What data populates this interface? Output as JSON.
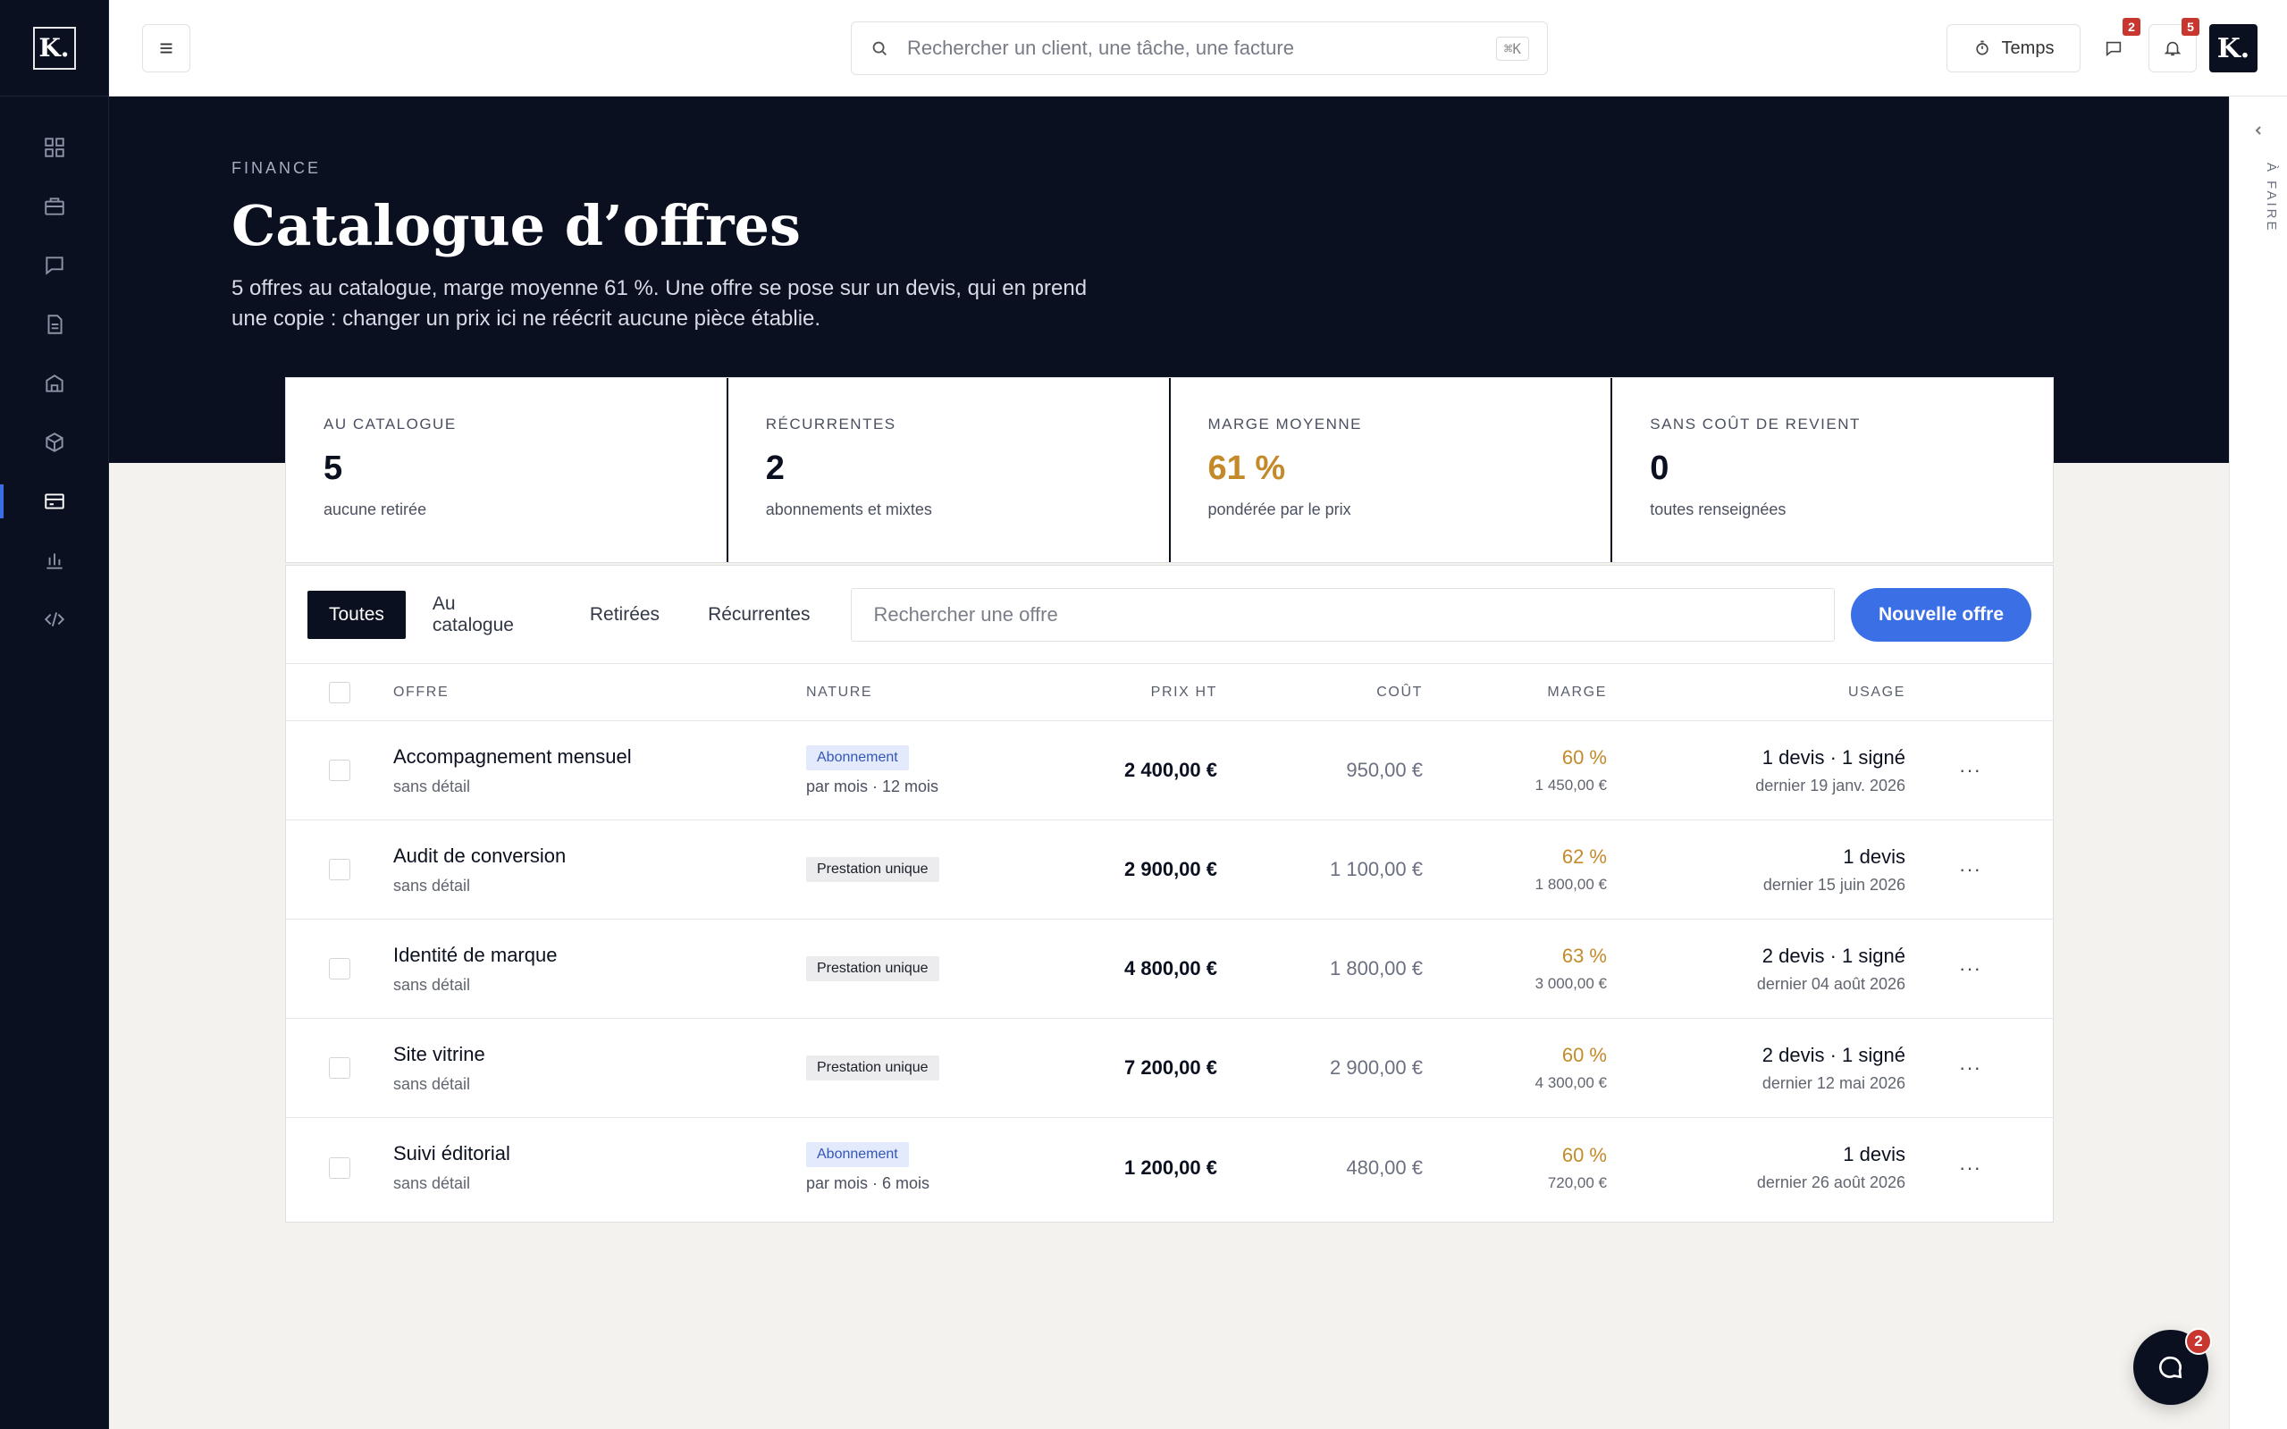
{
  "brand": {
    "logo": "K."
  },
  "sidebar": {
    "items": [
      {
        "name": "dashboard",
        "icon": "grid-icon"
      },
      {
        "name": "projects",
        "icon": "briefcase-icon"
      },
      {
        "name": "messages",
        "icon": "message-icon"
      },
      {
        "name": "documents",
        "icon": "document-icon"
      },
      {
        "name": "clients",
        "icon": "building-icon"
      },
      {
        "name": "products",
        "icon": "box-icon"
      },
      {
        "name": "finance",
        "icon": "card-icon",
        "active": true
      },
      {
        "name": "reports",
        "icon": "bar-chart-icon"
      },
      {
        "name": "developer",
        "icon": "code-icon"
      }
    ]
  },
  "topbar": {
    "search_placeholder": "Rechercher un client, une tâche, une facture",
    "search_shortcut": "⌘K",
    "timer_label": "Temps",
    "messages_badge": "2",
    "notifications_badge": "5",
    "avatar": "K."
  },
  "hero": {
    "eyebrow": "FINANCE",
    "title": "Catalogue d’offres",
    "description": "5 offres au catalogue, marge moyenne 61 %. Une offre se pose sur un devis, qui en prend une copie : changer un prix ici ne réécrit aucune pièce établie."
  },
  "rail": {
    "label": "À FAIRE"
  },
  "kpis": [
    {
      "label": "AU CATALOGUE",
      "value": "5",
      "sub": "aucune retirée",
      "accent": false
    },
    {
      "label": "RÉCURRENTES",
      "value": "2",
      "sub": "abonnements et mixtes",
      "accent": false
    },
    {
      "label": "MARGE MOYENNE",
      "value": "61 %",
      "sub": "pondérée par le prix",
      "accent": true
    },
    {
      "label": "SANS COÛT DE REVIENT",
      "value": "0",
      "sub": "toutes renseignées",
      "accent": false
    }
  ],
  "toolbar": {
    "tabs": [
      "Toutes",
      "Au catalogue",
      "Retirées",
      "Récurrentes"
    ],
    "active_tab": "Toutes",
    "search_placeholder": "Rechercher une offre",
    "new_button": "Nouvelle offre"
  },
  "table": {
    "headers": {
      "offre": "OFFRE",
      "nature": "NATURE",
      "prix": "PRIX HT",
      "cout": "COÛT",
      "marge": "MARGE",
      "usage": "USAGE"
    },
    "rows": [
      {
        "name": "Accompagnement mensuel",
        "detail": "sans détail",
        "nature": "Abonnement",
        "nature_type": "abo",
        "period": "par mois · 12 mois",
        "prix": "2 400,00 €",
        "cout": "950,00 €",
        "marge_pct": "60 %",
        "marge_abs": "1 450,00 €",
        "usage": "1 devis · 1 signé",
        "last": "dernier 19 janv. 2026"
      },
      {
        "name": "Audit de conversion",
        "detail": "sans détail",
        "nature": "Prestation unique",
        "nature_type": "uni",
        "period": "",
        "prix": "2 900,00 €",
        "cout": "1 100,00 €",
        "marge_pct": "62 %",
        "marge_abs": "1 800,00 €",
        "usage": "1 devis",
        "last": "dernier 15 juin 2026"
      },
      {
        "name": "Identité de marque",
        "detail": "sans détail",
        "nature": "Prestation unique",
        "nature_type": "uni",
        "period": "",
        "prix": "4 800,00 €",
        "cout": "1 800,00 €",
        "marge_pct": "63 %",
        "marge_abs": "3 000,00 €",
        "usage": "2 devis · 1 signé",
        "last": "dernier 04 août 2026"
      },
      {
        "name": "Site vitrine",
        "detail": "sans détail",
        "nature": "Prestation unique",
        "nature_type": "uni",
        "period": "",
        "prix": "7 200,00 €",
        "cout": "2 900,00 €",
        "marge_pct": "60 %",
        "marge_abs": "4 300,00 €",
        "usage": "2 devis · 1 signé",
        "last": "dernier 12 mai 2026"
      },
      {
        "name": "Suivi éditorial",
        "detail": "sans détail",
        "nature": "Abonnement",
        "nature_type": "abo",
        "period": "par mois · 6 mois",
        "prix": "1 200,00 €",
        "cout": "480,00 €",
        "marge_pct": "60 %",
        "marge_abs": "720,00 €",
        "usage": "1 devis",
        "last": "dernier 26 août 2026"
      }
    ],
    "row_action": "···"
  },
  "fab": {
    "badge": "2"
  },
  "colors": {
    "navy": "#0b1020",
    "accent": "#3b6fe5",
    "gold": "#c48a2a",
    "badge": "#c7372f"
  }
}
